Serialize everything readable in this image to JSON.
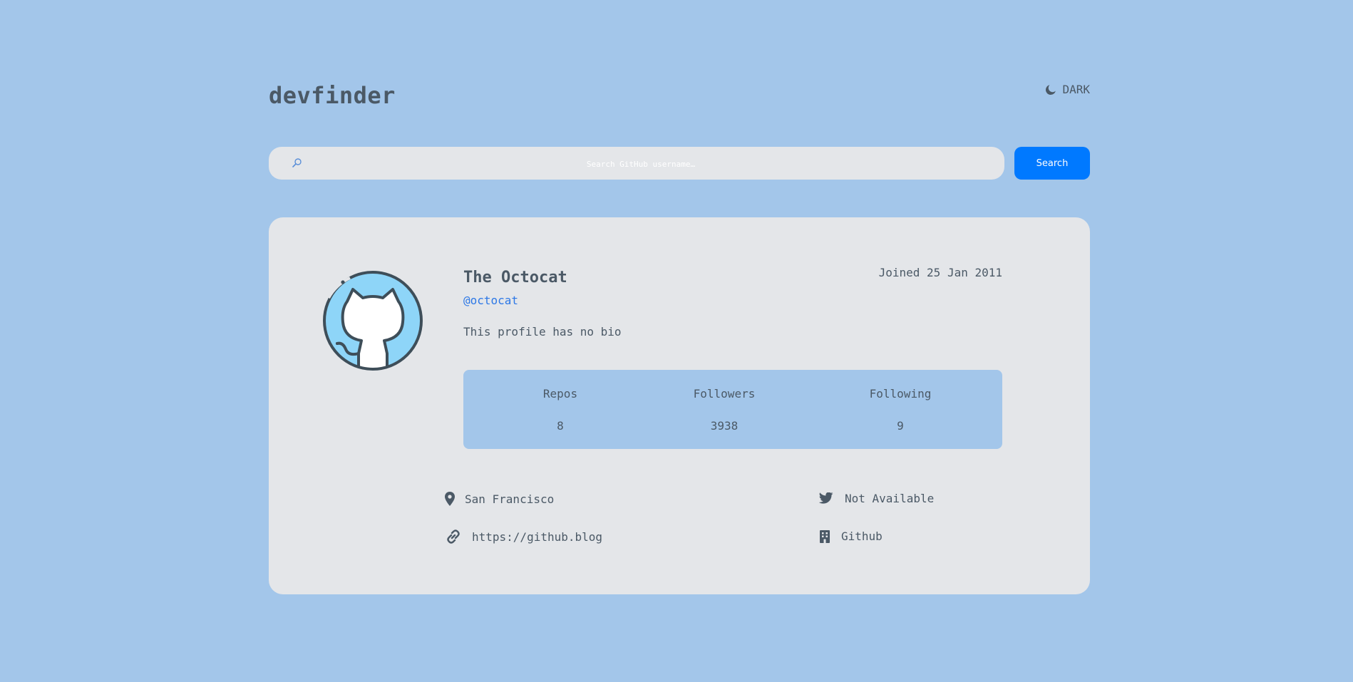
{
  "header": {
    "logo": "devfinder",
    "theme_toggle_label": "DARK"
  },
  "search": {
    "placeholder": "Search GitHub username…",
    "button_label": "Search"
  },
  "profile": {
    "name": "The Octocat",
    "login": "@octocat",
    "joined": "Joined 25 Jan 2011",
    "bio": "This profile has no bio",
    "stats": [
      {
        "label": "Repos",
        "value": "8"
      },
      {
        "label": "Followers",
        "value": "3938"
      },
      {
        "label": "Following",
        "value": "9"
      }
    ],
    "location": "San Francisco",
    "twitter": "Not Available",
    "blog": "https://github.blog",
    "company": "Github"
  },
  "icons": {
    "search": "search-icon",
    "theme": "moon-icon",
    "location": "map-pin-icon",
    "twitter": "twitter-icon",
    "blog": "link-icon",
    "company": "building-icon"
  },
  "colors": {
    "background": "#a3c6ea",
    "card": "#e4e6e9",
    "accent": "#0079ff",
    "login": "#2d78e6",
    "text": "#4b5966"
  }
}
